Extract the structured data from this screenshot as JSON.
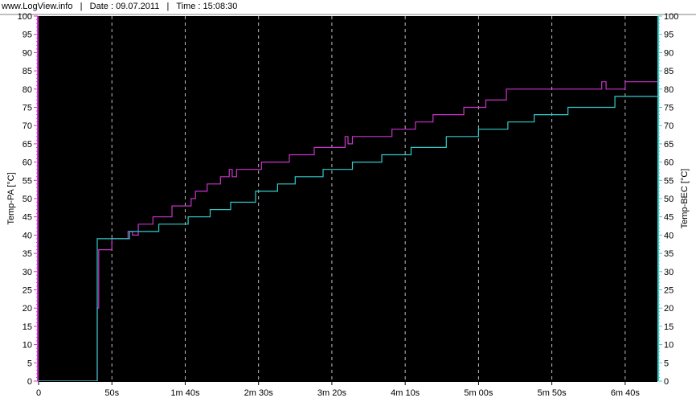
{
  "header": {
    "site": "www.LogView.info",
    "separator": "|",
    "date": "Date : 09.07.2011",
    "time": "Time : 15:08:30"
  },
  "colors": {
    "plot_background": "#000000",
    "grid": "#bfbfbf",
    "left_axis": "#cc33cc",
    "right_axis": "#33cccc",
    "series_pa": "#cc33cc",
    "series_bec": "#33cccc"
  },
  "chart_data": {
    "type": "line",
    "grid": true,
    "x_unit": "seconds",
    "xlim": [
      0,
      422
    ],
    "x_ticks": [
      {
        "value": 0,
        "label": "0"
      },
      {
        "value": 50,
        "label": "50s"
      },
      {
        "value": 100,
        "label": "1m 40s"
      },
      {
        "value": 150,
        "label": "2m 30s"
      },
      {
        "value": 200,
        "label": "3m 20s"
      },
      {
        "value": 250,
        "label": "4m 10s"
      },
      {
        "value": 300,
        "label": "5m 00s"
      },
      {
        "value": 350,
        "label": "5m 50s"
      },
      {
        "value": 400,
        "label": "6m 40s"
      }
    ],
    "y_left": {
      "label": "Temp-PA [°C]",
      "min": 0,
      "max": 100,
      "step": 5
    },
    "y_right": {
      "label": "Temp-BEC [°C]",
      "min": 0,
      "max": 100,
      "step": 5
    },
    "y_tick_labels": [
      "0",
      "5",
      "10",
      "15",
      "20",
      "25",
      "30",
      "35",
      "40",
      "45",
      "50",
      "55",
      "60",
      "65",
      "70",
      "75",
      "80",
      "85",
      "90",
      "95",
      "100"
    ],
    "series": [
      {
        "name": "Temp-PA [°C]",
        "axis": "left",
        "color": "#cc33cc",
        "points": [
          [
            0,
            0
          ],
          [
            40,
            0
          ],
          [
            40,
            20
          ],
          [
            41,
            20
          ],
          [
            41,
            36
          ],
          [
            50,
            36
          ],
          [
            50,
            39
          ],
          [
            61,
            39
          ],
          [
            61,
            41
          ],
          [
            64,
            41
          ],
          [
            64,
            40
          ],
          [
            68,
            40
          ],
          [
            68,
            43
          ],
          [
            78,
            43
          ],
          [
            78,
            45
          ],
          [
            91,
            45
          ],
          [
            91,
            48
          ],
          [
            104,
            48
          ],
          [
            104,
            50
          ],
          [
            107,
            50
          ],
          [
            107,
            52
          ],
          [
            115,
            52
          ],
          [
            115,
            54
          ],
          [
            124,
            54
          ],
          [
            124,
            56
          ],
          [
            130,
            56
          ],
          [
            130,
            58
          ],
          [
            132,
            58
          ],
          [
            132,
            56
          ],
          [
            135,
            56
          ],
          [
            135,
            58
          ],
          [
            152,
            58
          ],
          [
            152,
            60
          ],
          [
            171,
            60
          ],
          [
            171,
            62
          ],
          [
            188,
            62
          ],
          [
            188,
            64
          ],
          [
            209,
            64
          ],
          [
            209,
            67
          ],
          [
            211,
            67
          ],
          [
            211,
            65
          ],
          [
            214,
            65
          ],
          [
            214,
            67
          ],
          [
            241,
            67
          ],
          [
            241,
            69
          ],
          [
            257,
            69
          ],
          [
            257,
            71
          ],
          [
            269,
            71
          ],
          [
            269,
            73
          ],
          [
            290,
            73
          ],
          [
            290,
            75
          ],
          [
            305,
            75
          ],
          [
            305,
            77
          ],
          [
            319,
            77
          ],
          [
            319,
            80
          ],
          [
            384,
            80
          ],
          [
            384,
            82
          ],
          [
            387,
            82
          ],
          [
            387,
            80
          ],
          [
            400,
            80
          ],
          [
            400,
            82
          ],
          [
            422,
            82
          ]
        ]
      },
      {
        "name": "Temp-BEC [°C]",
        "axis": "right",
        "color": "#33cccc",
        "points": [
          [
            0,
            0
          ],
          [
            40,
            0
          ],
          [
            40,
            39
          ],
          [
            62,
            39
          ],
          [
            62,
            41
          ],
          [
            82,
            41
          ],
          [
            82,
            43
          ],
          [
            102,
            43
          ],
          [
            102,
            45
          ],
          [
            117,
            45
          ],
          [
            117,
            47
          ],
          [
            131,
            47
          ],
          [
            131,
            49
          ],
          [
            148,
            49
          ],
          [
            148,
            52
          ],
          [
            163,
            52
          ],
          [
            163,
            54
          ],
          [
            175,
            54
          ],
          [
            175,
            56
          ],
          [
            194,
            56
          ],
          [
            194,
            58
          ],
          [
            214,
            58
          ],
          [
            214,
            60
          ],
          [
            234,
            60
          ],
          [
            234,
            62
          ],
          [
            254,
            62
          ],
          [
            254,
            64
          ],
          [
            278,
            64
          ],
          [
            278,
            67
          ],
          [
            300,
            67
          ],
          [
            300,
            69
          ],
          [
            320,
            69
          ],
          [
            320,
            71
          ],
          [
            338,
            71
          ],
          [
            338,
            73
          ],
          [
            361,
            73
          ],
          [
            361,
            75
          ],
          [
            393,
            75
          ],
          [
            393,
            78
          ],
          [
            422,
            78
          ]
        ]
      }
    ]
  }
}
